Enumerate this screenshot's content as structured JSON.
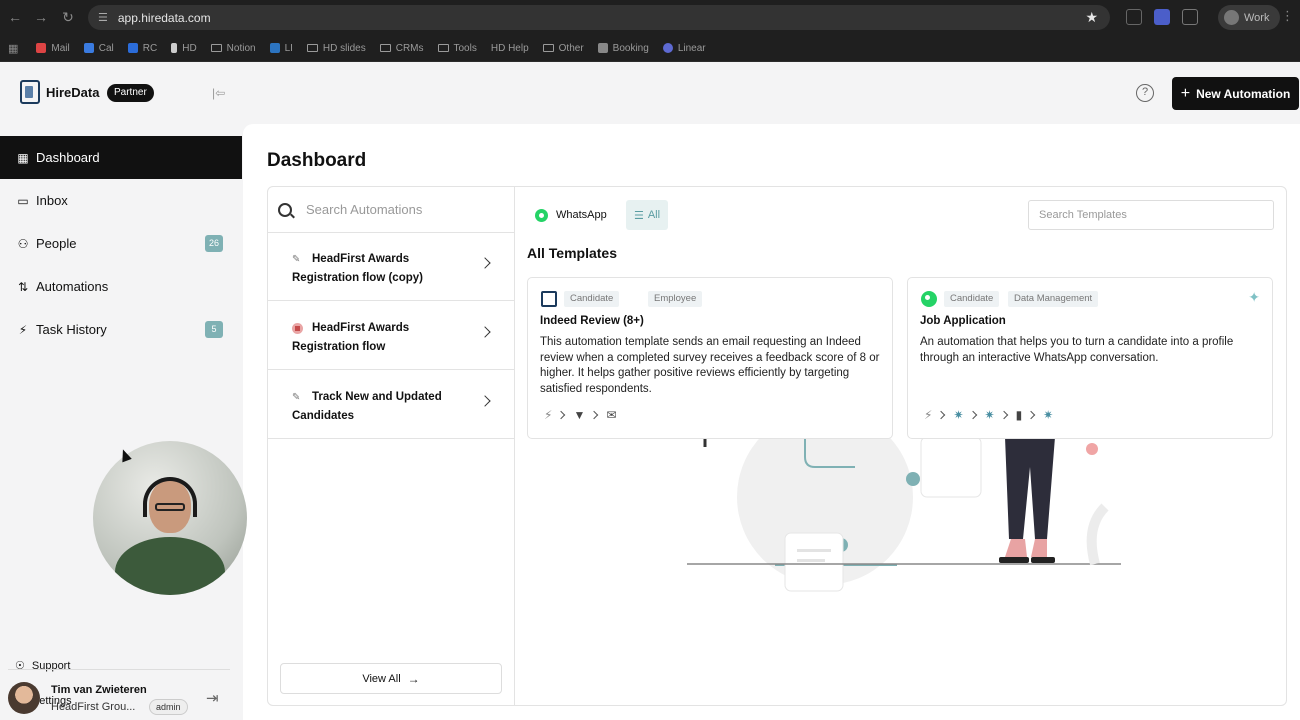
{
  "browser": {
    "url": "app.hiredata.com",
    "profile_label": "Work",
    "bookmarks": [
      "Mail",
      "Cal",
      "RC",
      "HD",
      "Notion",
      "LI",
      "HD slides",
      "CRMs",
      "Tools",
      "HD Help",
      "Other",
      "Booking",
      "Linear"
    ]
  },
  "header": {
    "brand": "HireData",
    "partner_badge": "Partner",
    "new_automation_label": "New Automation"
  },
  "sidebar": {
    "items": [
      {
        "label": "Dashboard",
        "icon": "grid-icon",
        "active": true
      },
      {
        "label": "Inbox",
        "icon": "inbox-icon"
      },
      {
        "label": "People",
        "icon": "people-icon",
        "badge": "26"
      },
      {
        "label": "Automations",
        "icon": "automations-icon"
      },
      {
        "label": "Task History",
        "icon": "bolt-icon",
        "badge": "5"
      }
    ],
    "support_label": "Support",
    "settings_label": "Settings",
    "user": {
      "name": "Tim van Zwieteren",
      "org": "HeadFirst Grou...",
      "role": "admin"
    }
  },
  "main": {
    "page_title": "Dashboard",
    "automations": {
      "search_placeholder": "Search Automations",
      "items": [
        {
          "title": "HeadFirst Awards Registration flow (copy)",
          "status": "draft"
        },
        {
          "title": "HeadFirst Awards Registration flow",
          "status": "stopped"
        },
        {
          "title": "Track New and Updated Candidates",
          "status": "draft"
        }
      ],
      "view_all_label": "View All"
    },
    "templates": {
      "filter_whatsapp": "WhatsApp",
      "filter_all": "All",
      "search_placeholder": "Search Templates",
      "section_title": "All Templates",
      "cards": [
        {
          "tags": [
            "Candidate",
            "Employee"
          ],
          "name": "Indeed Review (8+)",
          "description": "This automation template sends an email requesting an Indeed review when a completed survey receives a feedback score of 8 or higher. It helps gather positive reviews efficiently by targeting satisfied respondents."
        },
        {
          "tags": [
            "Candidate",
            "Data Management"
          ],
          "name": "Job Application",
          "description": "An automation that helps you to turn a candidate into a profile through an interactive WhatsApp conversation."
        }
      ]
    }
  },
  "colors": {
    "accent_teal": "#7fb1b4",
    "dark": "#111111",
    "whatsapp": "#25d366"
  }
}
